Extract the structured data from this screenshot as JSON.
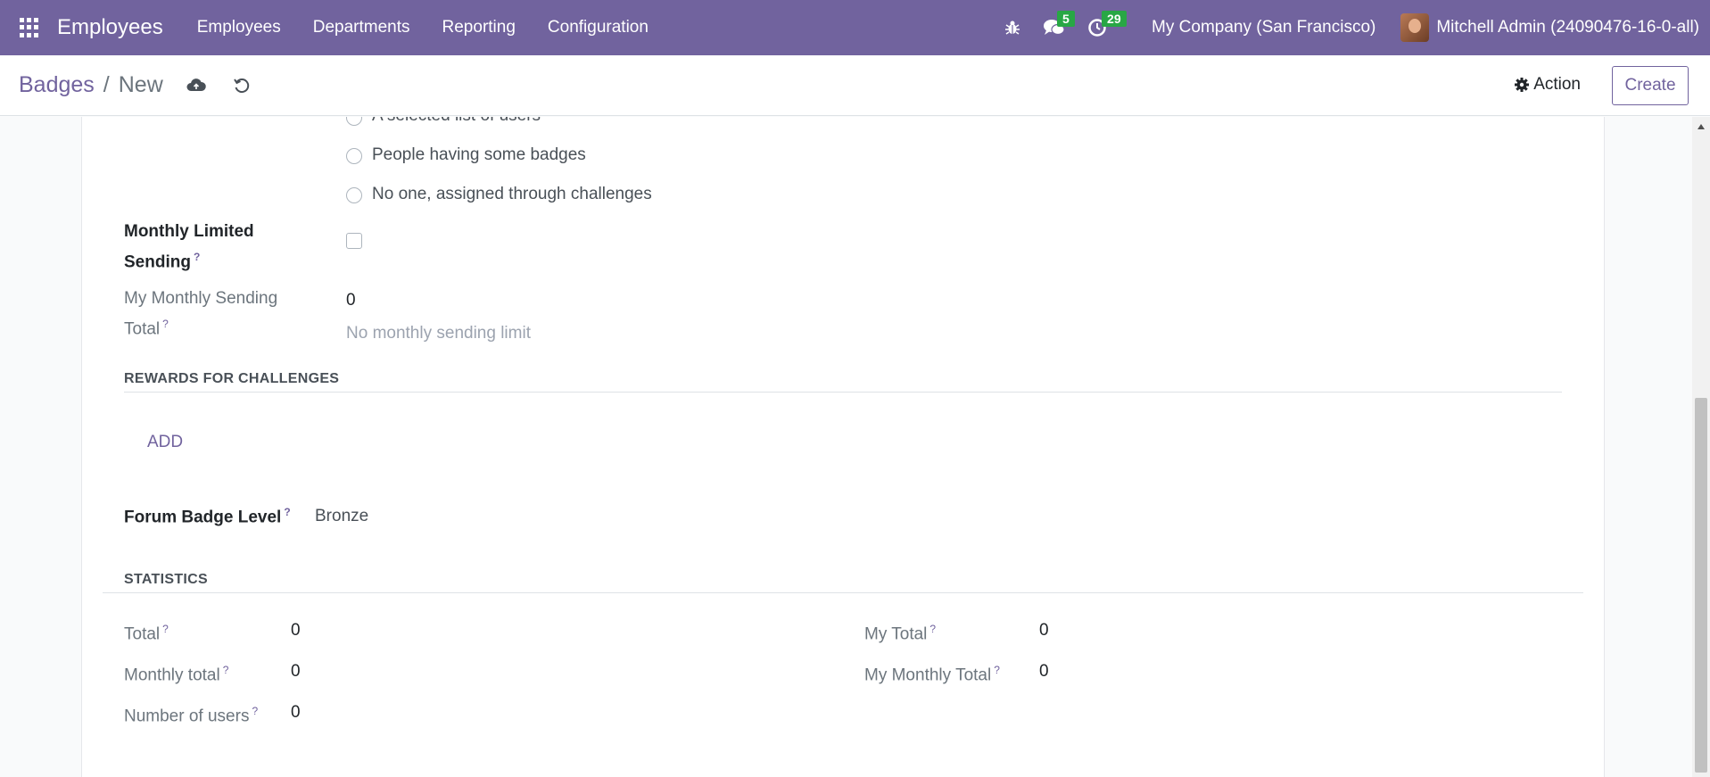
{
  "navbar": {
    "brand": "Employees",
    "menu": [
      "Employees",
      "Departments",
      "Reporting",
      "Configuration"
    ],
    "messages_count": "5",
    "activities_count": "29",
    "company": "My Company (San Francisco)",
    "user": "Mitchell Admin (24090476-16-0-all)"
  },
  "control": {
    "breadcrumb_parent": "Badges",
    "breadcrumb_sep": "/",
    "breadcrumb_current": "New",
    "action_label": "Action",
    "create_label": "Create"
  },
  "form": {
    "rule_options": [
      "A selected list of users",
      "People having some badges",
      "No one, assigned through challenges"
    ],
    "monthly_limited_label_1": "Monthly Limited",
    "monthly_limited_label_2": "Sending",
    "my_monthly_sending_label_1": "My Monthly Sending",
    "my_monthly_sending_label_2": "Total",
    "my_monthly_sending_value": "0",
    "no_limit_text": "No monthly sending limit",
    "rewards_title": "REWARDS FOR CHALLENGES",
    "add_label": "ADD",
    "forum_badge_level_label": "Forum Badge Level",
    "forum_badge_level_value": "Bronze",
    "help_mark": "?"
  },
  "statistics": {
    "title": "STATISTICS",
    "total_label": "Total",
    "total_value": "0",
    "monthly_total_label": "Monthly total",
    "monthly_total_value": "0",
    "number_users_label": "Number of users",
    "number_users_value": "0",
    "my_total_label": "My Total",
    "my_total_value": "0",
    "my_monthly_total_label": "My Monthly Total",
    "my_monthly_total_value": "0"
  },
  "colors": {
    "brand": "#71639e",
    "badge_green": "#28a745"
  },
  "icons": [
    "apps-grid-icon",
    "bug-icon",
    "chat-icon",
    "clock-icon",
    "cloud-upload-icon",
    "undo-icon",
    "gear-icon"
  ]
}
